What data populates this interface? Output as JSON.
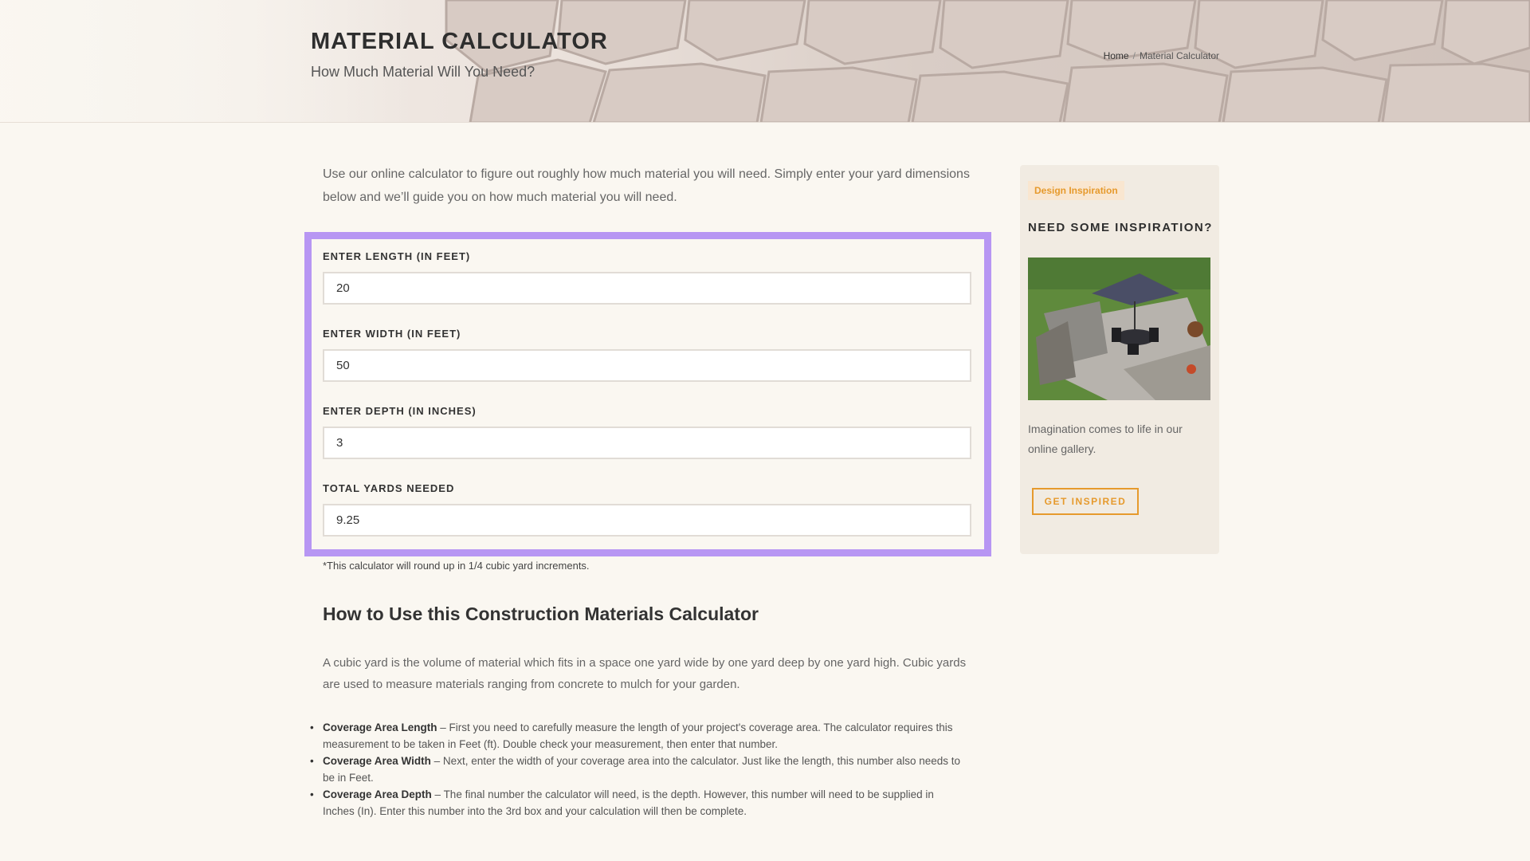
{
  "header": {
    "title": "MATERIAL CALCULATOR",
    "subtitle": "How Much Material Will You Need?",
    "breadcrumb": {
      "home": "Home",
      "separator": "/",
      "current": "Material Calculator"
    }
  },
  "main": {
    "intro": "Use our online calculator to figure out roughly how much material you will need. Simply enter your yard dimensions below and we’ll guide you on how much material you will need.",
    "calculator": {
      "length_label": "ENTER LENGTH (IN FEET)",
      "length_value": "20",
      "width_label": "ENTER WIDTH (IN FEET)",
      "width_value": "50",
      "depth_label": "ENTER DEPTH (IN INCHES)",
      "depth_value": "3",
      "total_label": "TOTAL YARDS NEEDED",
      "total_value": "9.25"
    },
    "note": "*This calculator will round up in 1/4 cubic yard increments.",
    "howto_heading": "How to Use this Construction Materials Calculator",
    "howto_paragraph": "A cubic yard is the volume of material which fits in a space one yard wide by one yard deep by one yard high. Cubic yards are used to measure materials ranging from concrete to mulch for your garden.",
    "bullets": [
      {
        "term": "Coverage Area Length",
        "text": " – First you need to carefully measure the length of your project's coverage area. The calculator requires this measurement to be taken in Feet (ft). Double check your measurement, then enter that number."
      },
      {
        "term": "Coverage Area Width",
        "text": " – Next, enter the width of your coverage area into the calculator. Just like the length, this number also needs to be in Feet."
      },
      {
        "term": "Coverage Area Depth",
        "text": " – The final number the calculator will need, is the depth. However, this number will need to be supplied in Inches (In). Enter this number into the 3rd box and your calculation will then be complete."
      }
    ]
  },
  "sidebar": {
    "tag": "Design Inspiration",
    "title": "NEED SOME INSPIRATION?",
    "text": "Imagination comes to life in our online gallery.",
    "button": "GET INSPIRED"
  },
  "colors": {
    "accent_purple": "#b796f3",
    "accent_orange": "#e69a2d",
    "background": "#faf7f1",
    "sidebar_bg": "#f1ebe2"
  }
}
